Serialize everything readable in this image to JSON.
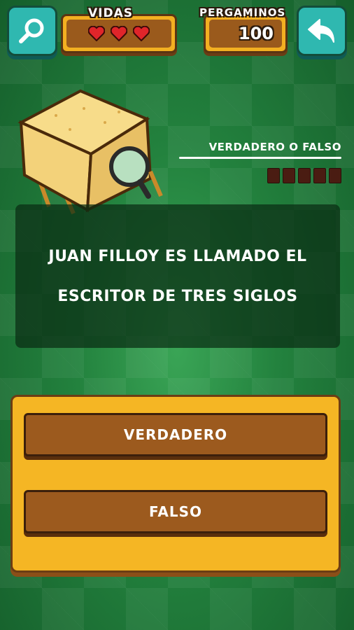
{
  "header": {
    "search_icon": "magnifier-icon",
    "lives_label": "VIDAS",
    "lives_count": 3,
    "scrolls_label": "PERGAMINOS",
    "scrolls_value": "100",
    "back_icon": "back-arrow-icon"
  },
  "mode": {
    "label": "VERDADERO O FALSO",
    "progress_total": 5,
    "progress_done": 0
  },
  "question": {
    "text": "JUAN FILLOY ES LLAMADO EL ESCRITOR DE TRES SIGLOS"
  },
  "answers": {
    "true_label": "VERDADERO",
    "false_label": "FALSO"
  },
  "colors": {
    "background": "#23823e",
    "panel_orange": "#f3b021",
    "button_brown": "#9c5a1e",
    "teal": "#2fb8b0",
    "heart_red": "#e0252a"
  }
}
